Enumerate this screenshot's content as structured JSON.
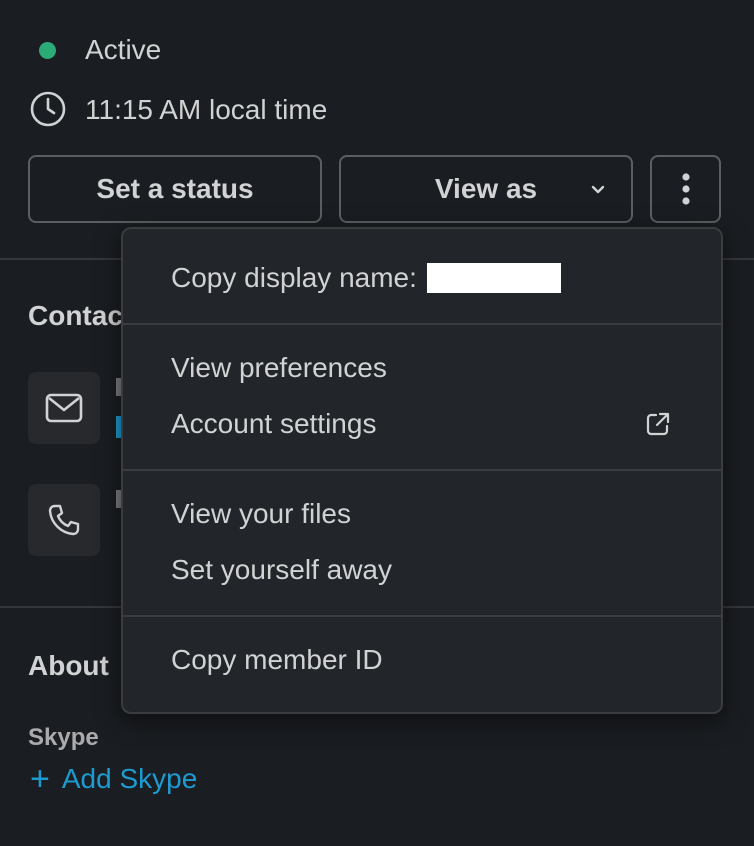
{
  "presence": {
    "status": "Active",
    "local_time": "11:15 AM local time"
  },
  "actions": {
    "set_status": "Set a status",
    "view_as": "View as"
  },
  "sections": {
    "contact_title": "Contac",
    "about_title": "About"
  },
  "about": {
    "skype_label": "Skype",
    "add_skype": "Add Skype"
  },
  "menu": {
    "copy_display_name": "Copy display name:",
    "view_preferences": "View preferences",
    "account_settings": "Account settings",
    "view_files": "View your files",
    "set_away": "Set yourself away",
    "copy_member_id": "Copy member ID"
  },
  "colors": {
    "presence_active": "#2bac76",
    "link": "#1d9bd1",
    "background": "#1a1d21",
    "menu_bg": "#222529"
  },
  "icons": [
    "clock-icon",
    "chevron-down-icon",
    "more-vertical-icon",
    "mail-icon",
    "phone-icon",
    "external-link-icon",
    "plus-icon"
  ]
}
